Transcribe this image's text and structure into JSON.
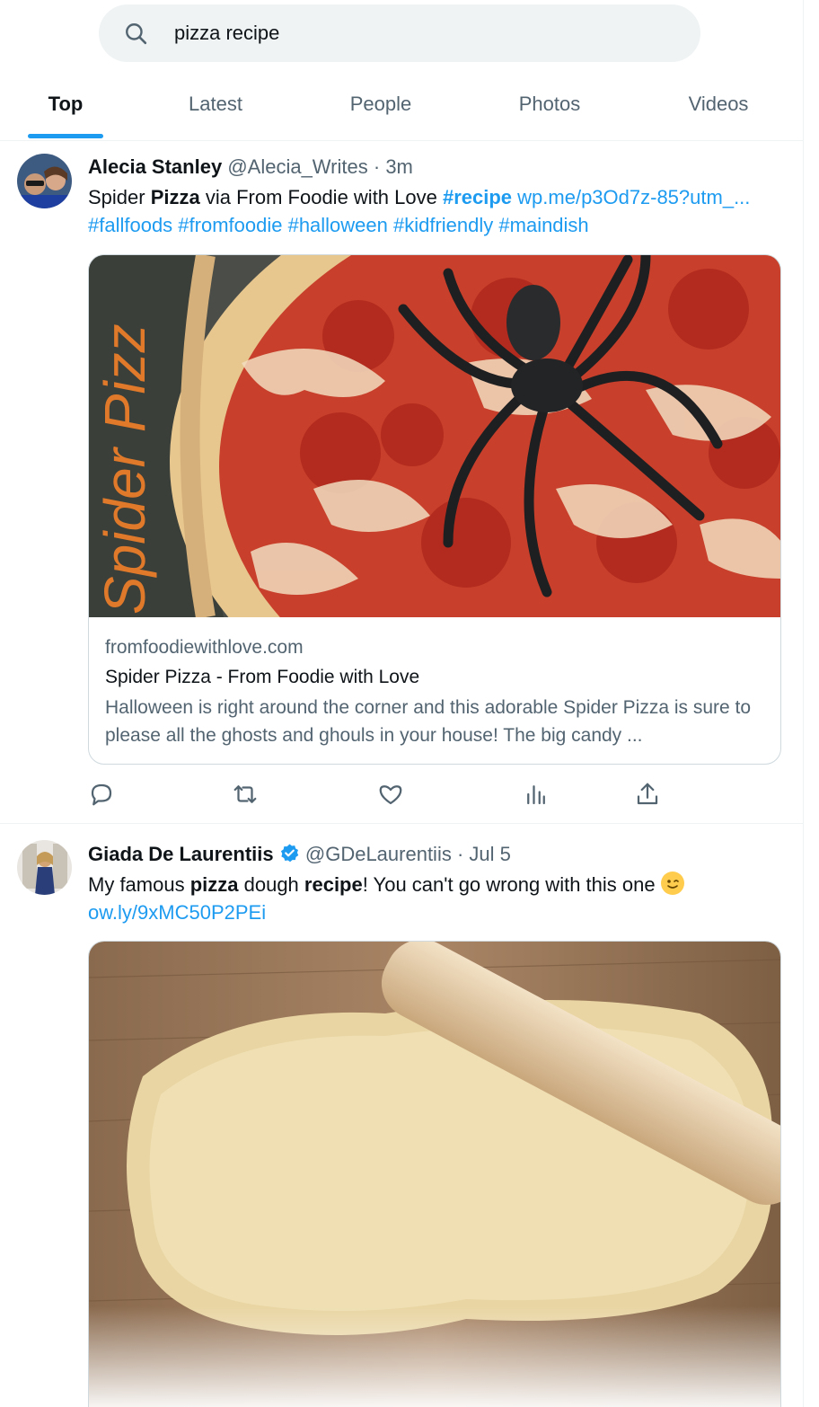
{
  "search": {
    "query": "pizza recipe"
  },
  "tabs": [
    {
      "label": "Top",
      "active": true
    },
    {
      "label": "Latest",
      "active": false
    },
    {
      "label": "People",
      "active": false
    },
    {
      "label": "Photos",
      "active": false
    },
    {
      "label": "Videos",
      "active": false
    }
  ],
  "tweets": [
    {
      "display_name": "Alecia Stanley",
      "handle": "@Alecia_Writes",
      "separator": "·",
      "time": "3m",
      "text_parts": [
        "Spider ",
        "Pizza",
        " via From Foodie with Love ",
        "#recipe",
        " wp.me/p3Od7z-85?utm_...",
        "#fallfoods #fromfoodie #halloween #kidfriendly #maindish"
      ],
      "card": {
        "image_text": "Spider Pizz",
        "domain": "fromfoodiewithlove.com",
        "title": "Spider Pizza - From Foodie with Love",
        "description": "Halloween is right around the corner and this adorable Spider Pizza is sure to please all the ghosts and ghouls in your house! The big candy ..."
      },
      "actions": [
        "reply-icon",
        "retweet-icon",
        "like-icon",
        "views-icon",
        "share-icon"
      ]
    },
    {
      "display_name": "Giada De Laurentiis",
      "verified": true,
      "handle": "@GDeLaurentiis",
      "separator": "·",
      "time": "Jul 5",
      "text_parts": [
        "My famous ",
        "pizza",
        " dough ",
        "recipe",
        "! You can't go wrong with this one ",
        "ow.ly/9xMC50P2PEi"
      ],
      "emoji": "winking-face"
    }
  ],
  "colors": {
    "accent": "#1d9bf0",
    "text": "#0f1419",
    "muted": "#536471",
    "border": "#cfd9de"
  }
}
